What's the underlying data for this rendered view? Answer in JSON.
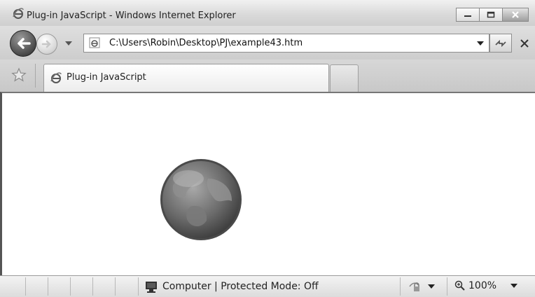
{
  "window": {
    "title": "Plug-in JavaScript - Windows Internet Explorer"
  },
  "address_bar": {
    "url": "C:\\Users\\Robin\\Desktop\\PJ\\example43.htm"
  },
  "tabs": [
    {
      "label": "Plug-in JavaScript",
      "active": true
    }
  ],
  "content": {
    "object_icon": "globe-icon"
  },
  "status_bar": {
    "zone": "Computer | Protected Mode: Off",
    "zoom": "100%"
  },
  "colors": {
    "chrome": "#d9d9d9",
    "globe_dark": "#555555",
    "globe_light": "#9a9a9a"
  }
}
